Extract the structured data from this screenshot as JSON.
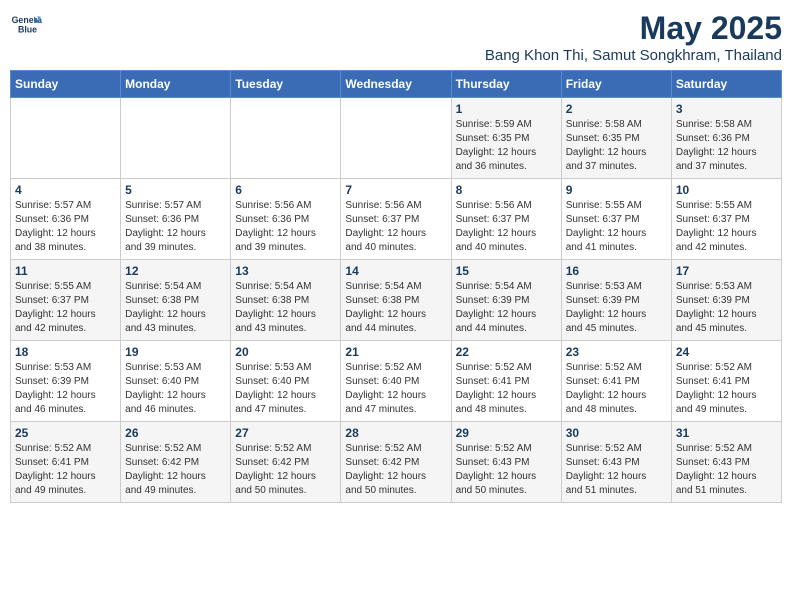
{
  "logo": {
    "line1": "General",
    "line2": "Blue"
  },
  "title": "May 2025",
  "subtitle": "Bang Khon Thi, Samut Songkhram, Thailand",
  "days_of_week": [
    "Sunday",
    "Monday",
    "Tuesday",
    "Wednesday",
    "Thursday",
    "Friday",
    "Saturday"
  ],
  "weeks": [
    [
      {
        "day": "",
        "info": ""
      },
      {
        "day": "",
        "info": ""
      },
      {
        "day": "",
        "info": ""
      },
      {
        "day": "",
        "info": ""
      },
      {
        "day": "1",
        "info": "Sunrise: 5:59 AM\nSunset: 6:35 PM\nDaylight: 12 hours\nand 36 minutes."
      },
      {
        "day": "2",
        "info": "Sunrise: 5:58 AM\nSunset: 6:35 PM\nDaylight: 12 hours\nand 37 minutes."
      },
      {
        "day": "3",
        "info": "Sunrise: 5:58 AM\nSunset: 6:36 PM\nDaylight: 12 hours\nand 37 minutes."
      }
    ],
    [
      {
        "day": "4",
        "info": "Sunrise: 5:57 AM\nSunset: 6:36 PM\nDaylight: 12 hours\nand 38 minutes."
      },
      {
        "day": "5",
        "info": "Sunrise: 5:57 AM\nSunset: 6:36 PM\nDaylight: 12 hours\nand 39 minutes."
      },
      {
        "day": "6",
        "info": "Sunrise: 5:56 AM\nSunset: 6:36 PM\nDaylight: 12 hours\nand 39 minutes."
      },
      {
        "day": "7",
        "info": "Sunrise: 5:56 AM\nSunset: 6:37 PM\nDaylight: 12 hours\nand 40 minutes."
      },
      {
        "day": "8",
        "info": "Sunrise: 5:56 AM\nSunset: 6:37 PM\nDaylight: 12 hours\nand 40 minutes."
      },
      {
        "day": "9",
        "info": "Sunrise: 5:55 AM\nSunset: 6:37 PM\nDaylight: 12 hours\nand 41 minutes."
      },
      {
        "day": "10",
        "info": "Sunrise: 5:55 AM\nSunset: 6:37 PM\nDaylight: 12 hours\nand 42 minutes."
      }
    ],
    [
      {
        "day": "11",
        "info": "Sunrise: 5:55 AM\nSunset: 6:37 PM\nDaylight: 12 hours\nand 42 minutes."
      },
      {
        "day": "12",
        "info": "Sunrise: 5:54 AM\nSunset: 6:38 PM\nDaylight: 12 hours\nand 43 minutes."
      },
      {
        "day": "13",
        "info": "Sunrise: 5:54 AM\nSunset: 6:38 PM\nDaylight: 12 hours\nand 43 minutes."
      },
      {
        "day": "14",
        "info": "Sunrise: 5:54 AM\nSunset: 6:38 PM\nDaylight: 12 hours\nand 44 minutes."
      },
      {
        "day": "15",
        "info": "Sunrise: 5:54 AM\nSunset: 6:39 PM\nDaylight: 12 hours\nand 44 minutes."
      },
      {
        "day": "16",
        "info": "Sunrise: 5:53 AM\nSunset: 6:39 PM\nDaylight: 12 hours\nand 45 minutes."
      },
      {
        "day": "17",
        "info": "Sunrise: 5:53 AM\nSunset: 6:39 PM\nDaylight: 12 hours\nand 45 minutes."
      }
    ],
    [
      {
        "day": "18",
        "info": "Sunrise: 5:53 AM\nSunset: 6:39 PM\nDaylight: 12 hours\nand 46 minutes."
      },
      {
        "day": "19",
        "info": "Sunrise: 5:53 AM\nSunset: 6:40 PM\nDaylight: 12 hours\nand 46 minutes."
      },
      {
        "day": "20",
        "info": "Sunrise: 5:53 AM\nSunset: 6:40 PM\nDaylight: 12 hours\nand 47 minutes."
      },
      {
        "day": "21",
        "info": "Sunrise: 5:52 AM\nSunset: 6:40 PM\nDaylight: 12 hours\nand 47 minutes."
      },
      {
        "day": "22",
        "info": "Sunrise: 5:52 AM\nSunset: 6:41 PM\nDaylight: 12 hours\nand 48 minutes."
      },
      {
        "day": "23",
        "info": "Sunrise: 5:52 AM\nSunset: 6:41 PM\nDaylight: 12 hours\nand 48 minutes."
      },
      {
        "day": "24",
        "info": "Sunrise: 5:52 AM\nSunset: 6:41 PM\nDaylight: 12 hours\nand 49 minutes."
      }
    ],
    [
      {
        "day": "25",
        "info": "Sunrise: 5:52 AM\nSunset: 6:41 PM\nDaylight: 12 hours\nand 49 minutes."
      },
      {
        "day": "26",
        "info": "Sunrise: 5:52 AM\nSunset: 6:42 PM\nDaylight: 12 hours\nand 49 minutes."
      },
      {
        "day": "27",
        "info": "Sunrise: 5:52 AM\nSunset: 6:42 PM\nDaylight: 12 hours\nand 50 minutes."
      },
      {
        "day": "28",
        "info": "Sunrise: 5:52 AM\nSunset: 6:42 PM\nDaylight: 12 hours\nand 50 minutes."
      },
      {
        "day": "29",
        "info": "Sunrise: 5:52 AM\nSunset: 6:43 PM\nDaylight: 12 hours\nand 50 minutes."
      },
      {
        "day": "30",
        "info": "Sunrise: 5:52 AM\nSunset: 6:43 PM\nDaylight: 12 hours\nand 51 minutes."
      },
      {
        "day": "31",
        "info": "Sunrise: 5:52 AM\nSunset: 6:43 PM\nDaylight: 12 hours\nand 51 minutes."
      }
    ]
  ]
}
